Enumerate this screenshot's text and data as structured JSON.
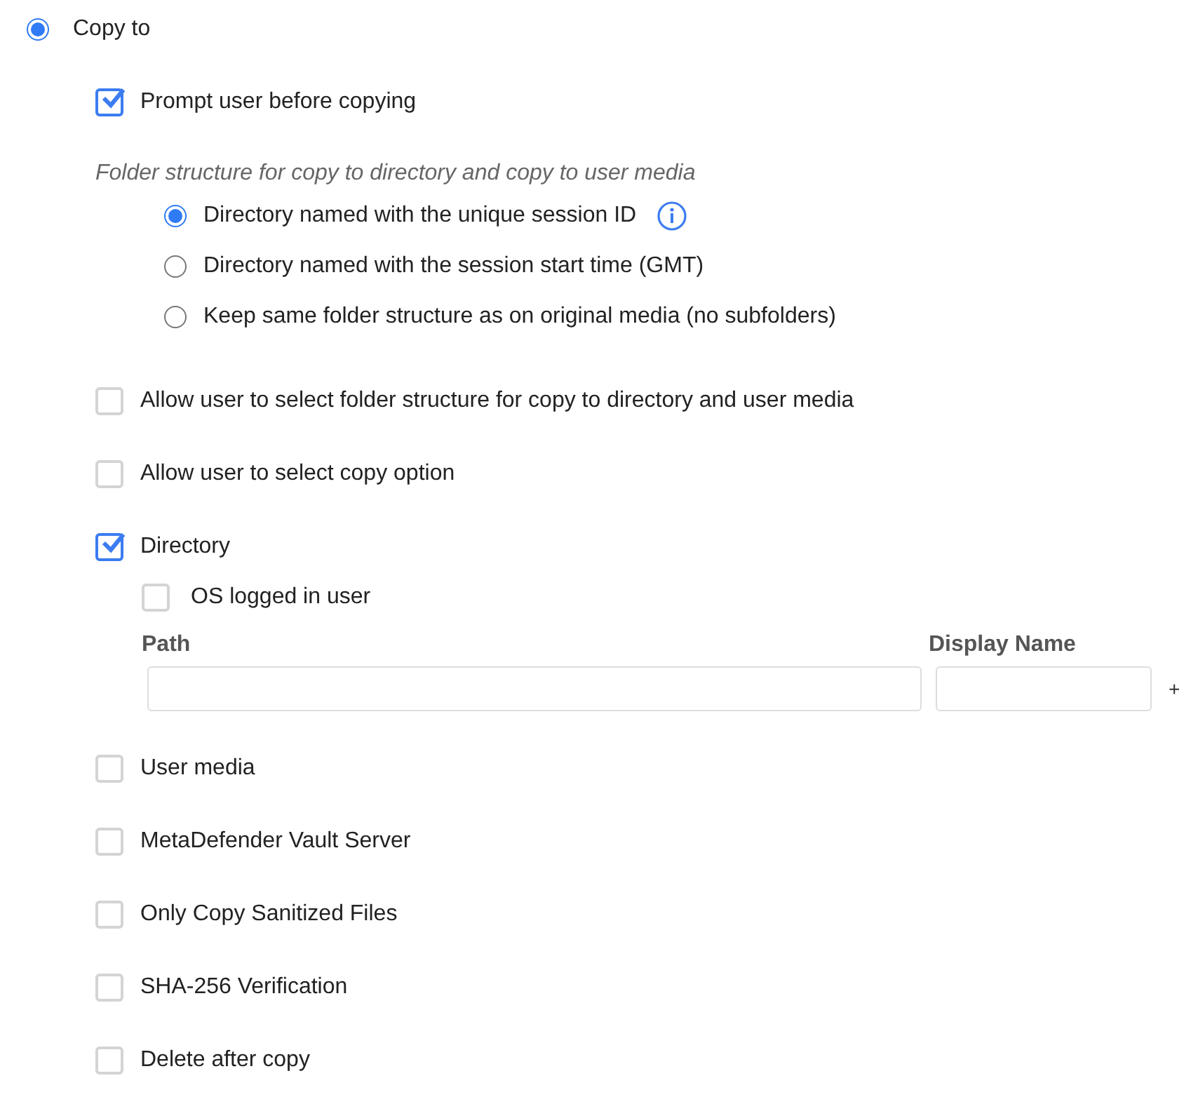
{
  "copy_to": {
    "label": "Copy to",
    "selected": true
  },
  "items": [
    {
      "kind": "checkbox",
      "label": "Prompt user before copying",
      "checked": true
    },
    {
      "kind": "radio_group",
      "caption": "Folder structure for copy to directory and copy to user media",
      "options": [
        {
          "label": "Directory named with the unique session ID",
          "selected": true,
          "info": true
        },
        {
          "label": "Directory named with the session start time (GMT)",
          "selected": false,
          "info": false
        },
        {
          "label": "Keep same folder structure as on original media (no subfolders)",
          "selected": false,
          "info": false
        }
      ]
    },
    {
      "kind": "checkbox",
      "label": "Allow user to select folder structure for copy to directory and user media",
      "checked": false
    },
    {
      "kind": "checkbox",
      "label": "Allow user to select copy option",
      "checked": false
    },
    {
      "kind": "directory",
      "label": "Directory",
      "checked": true,
      "os_user": {
        "label": "OS logged in user",
        "checked": false
      },
      "path_label": "Path",
      "display_name_label": "Display Name",
      "add": "+"
    },
    {
      "kind": "checkbox",
      "label": "User media",
      "checked": false
    },
    {
      "kind": "checkbox",
      "label": "MetaDefender Vault Server",
      "checked": false
    },
    {
      "kind": "checkbox",
      "label": "Only Copy Sanitized Files",
      "checked": false
    },
    {
      "kind": "checkbox",
      "label": "SHA-256 Verification",
      "checked": false
    },
    {
      "kind": "checkbox",
      "label": "Delete after copy",
      "checked": false
    }
  ]
}
